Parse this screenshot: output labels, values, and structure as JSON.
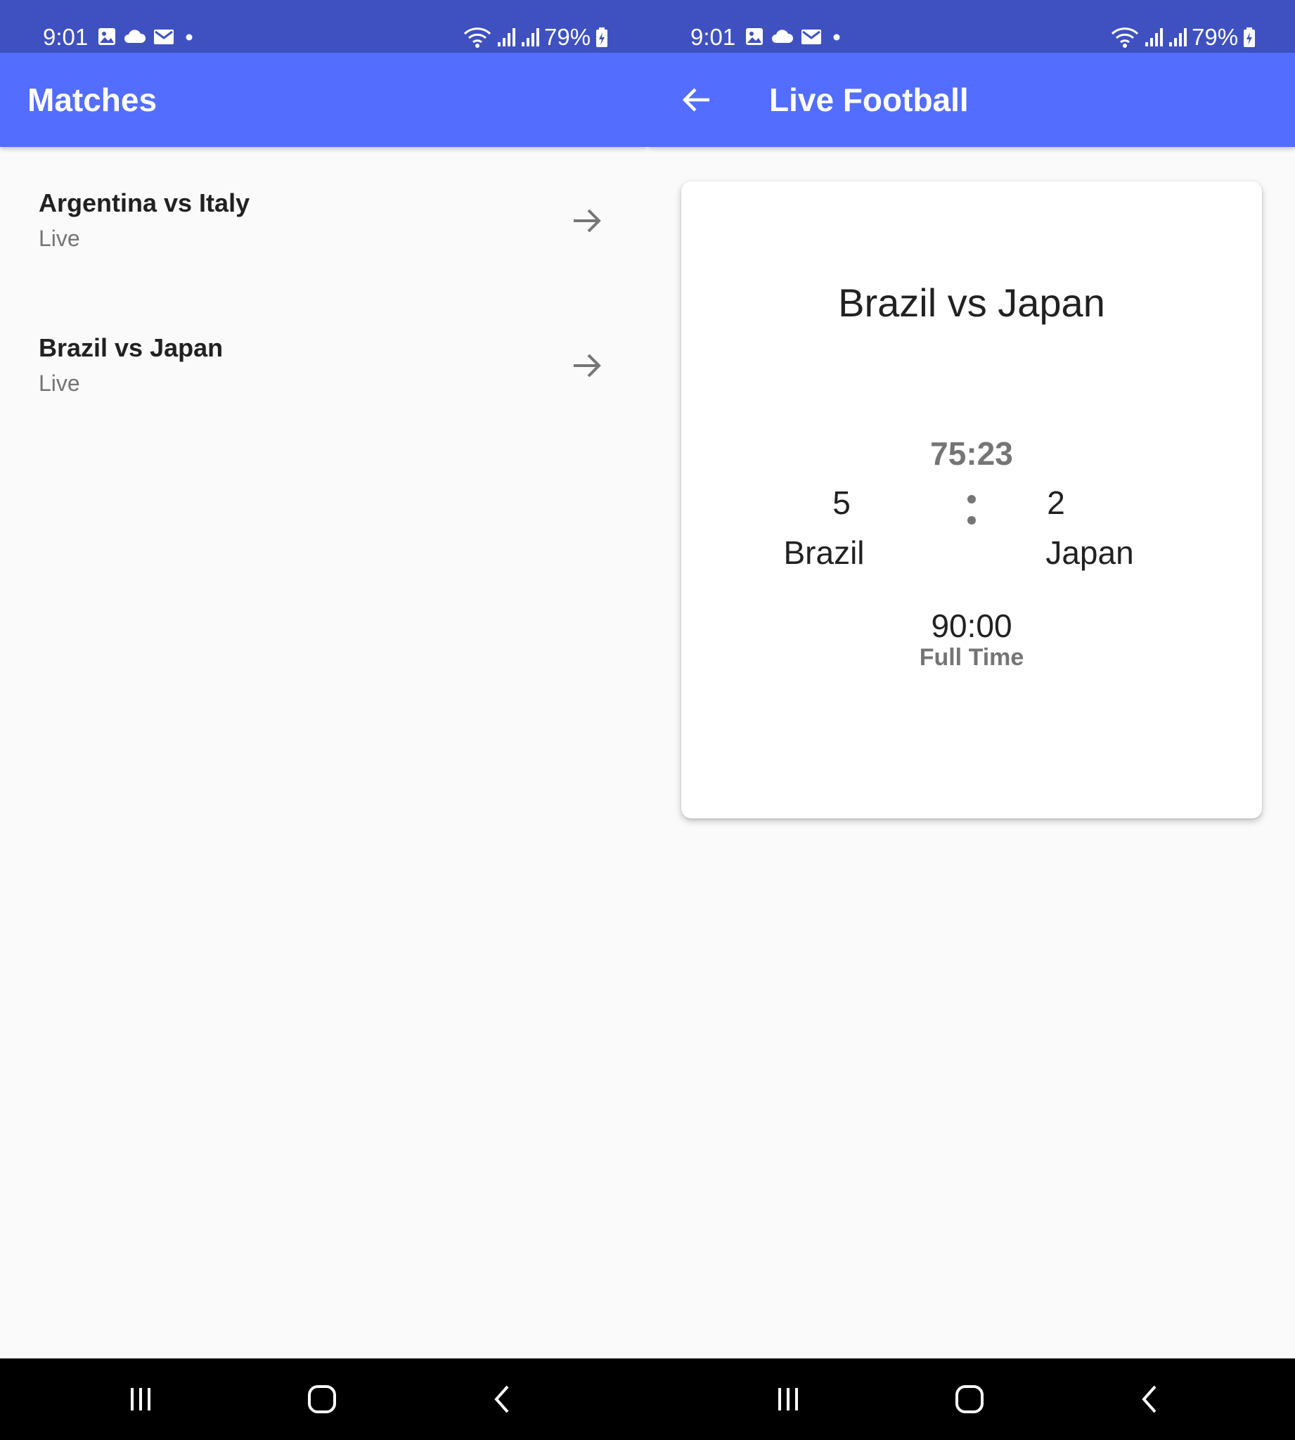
{
  "status_bar": {
    "time": "9:01",
    "battery": "79%",
    "color": "#3f51c0"
  },
  "screens": {
    "left": {
      "title": "Matches",
      "matches": [
        {
          "name": "Argentina vs Italy",
          "status": "Live"
        },
        {
          "name": "Brazil vs Japan",
          "status": "Live"
        }
      ]
    },
    "right": {
      "title": "Live Football",
      "card": {
        "title": "Brazil vs Japan",
        "clock": "75:23",
        "home_score": "5",
        "away_score": "2",
        "home_team": "Brazil",
        "away_team": "Japan",
        "final_time": "90:00",
        "final_label": "Full Time"
      }
    }
  },
  "icons": {
    "status_left": [
      "gallery-icon",
      "cloud-icon",
      "mail-icon",
      "dot-icon"
    ],
    "status_right": [
      "wifi-icon",
      "signal-icon",
      "signal-icon",
      "battery-charging-icon"
    ],
    "list_item": "arrow-forward-icon",
    "app_bar_back": "arrow-back-icon",
    "nav": [
      "recent-apps-icon",
      "home-icon",
      "back-icon"
    ]
  },
  "colors": {
    "app_bar": "#536dfe",
    "status_bar": "#3f51c0",
    "background": "#fafafa",
    "card": "#ffffff",
    "primary_text": "#212121",
    "secondary_text": "#757575"
  }
}
